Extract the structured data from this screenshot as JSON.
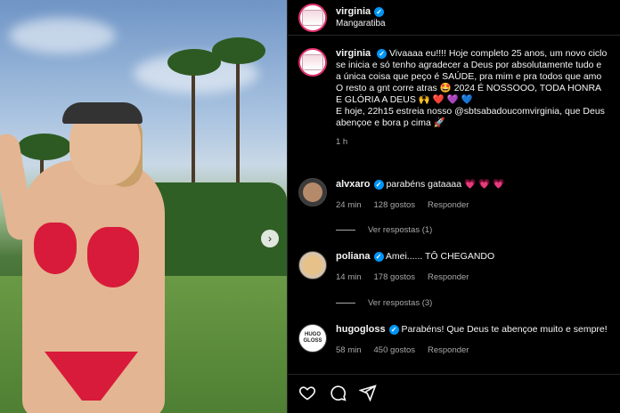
{
  "post": {
    "username": "virginia",
    "location": "Mangaratiba",
    "caption_lines": [
      "Vivaaaa eu!!!! Hoje completo 25 anos, um novo ciclo",
      "se inicia e só tenho agradecer a Deus por absolutamente tudo e",
      "a única coisa que peço é SAÚDE, pra mim e pra todos que amo",
      "O resto a gnt corre atras 🤩 2024 É NOSSOOO, TODA HONRA",
      "E GLÓRIA A DEUS 🙌 ❤️ 💜 💙",
      "E hoje, 22h15 estreia nosso @sbtsabadoucomvirginia, que Deus",
      "abençoe e bora p cima 🚀"
    ],
    "time": "1 h"
  },
  "comments": [
    {
      "username": "alvxaro",
      "text": "parabéns gataaaa 💗 💗 💗",
      "time": "24 min",
      "likes": "128 gostos",
      "reply": "Responder",
      "view_replies": "Ver respostas (1)"
    },
    {
      "username": "poliana",
      "text": "Amei...... TÔ CHEGANDO",
      "time": "14 min",
      "likes": "178 gostos",
      "reply": "Responder",
      "view_replies": "Ver respostas (3)"
    },
    {
      "username": "hugogloss",
      "text": "Parabéns! Que Deus te abençoe muito e sempre!",
      "time": "58 min",
      "likes": "450 gostos",
      "reply": "Responder"
    }
  ],
  "icons": {
    "carousel_next": "chevron-right-icon",
    "like": "heart-icon",
    "comment": "comment-icon",
    "share": "send-icon",
    "verified": "verified-badge-icon"
  },
  "colors": {
    "verified": "#0095f6",
    "background": "#000000",
    "muted_text": "#a8a8a8"
  }
}
